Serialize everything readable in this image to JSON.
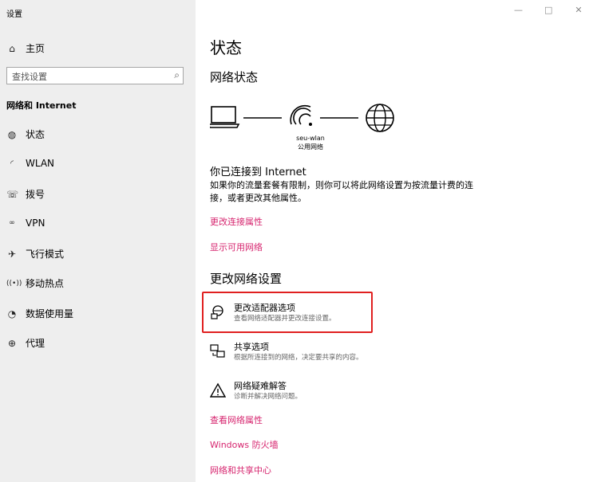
{
  "window": {
    "title": "设置",
    "controls": [
      "—",
      "□",
      "✕"
    ]
  },
  "sidebar": {
    "home_label": "主页",
    "search_placeholder": "查找设置",
    "section_title": "网络和 Internet",
    "items": [
      {
        "label": "状态",
        "icon": "status-globe-icon"
      },
      {
        "label": "WLAN",
        "icon": "wifi-icon"
      },
      {
        "label": "拨号",
        "icon": "dial-up-icon"
      },
      {
        "label": "VPN",
        "icon": "vpn-icon"
      },
      {
        "label": "飞行模式",
        "icon": "airplane-icon"
      },
      {
        "label": "移动热点",
        "icon": "hotspot-icon"
      },
      {
        "label": "数据使用量",
        "icon": "data-usage-icon"
      },
      {
        "label": "代理",
        "icon": "proxy-globe-icon"
      }
    ]
  },
  "main": {
    "title": "状态",
    "network_status_heading": "网络状态",
    "network": {
      "ssid": "seu-wlan",
      "type": "公用网络"
    },
    "connected_heading": "你已连接到 Internet",
    "connected_desc": "如果你的流量套餐有限制，则你可以将此网络设置为按流量计费的连接，或者更改其他属性。",
    "link_change_props": "更改连接属性",
    "link_show_networks": "显示可用网络",
    "change_settings_heading": "更改网络设置",
    "options": [
      {
        "title": "更改适配器选项",
        "desc": "查看网络适配器并更改连接设置。",
        "icon": "adapter-icon"
      },
      {
        "title": "共享选项",
        "desc": "根据所连接到的网络，决定要共享的内容。",
        "icon": "sharing-icon"
      },
      {
        "title": "网络疑难解答",
        "desc": "诊断并解决网络问题。",
        "icon": "warning-icon"
      }
    ],
    "link_view_props": "查看网络属性",
    "link_firewall": "Windows 防火墙",
    "link_sharing_center": "网络和共享中心"
  }
}
